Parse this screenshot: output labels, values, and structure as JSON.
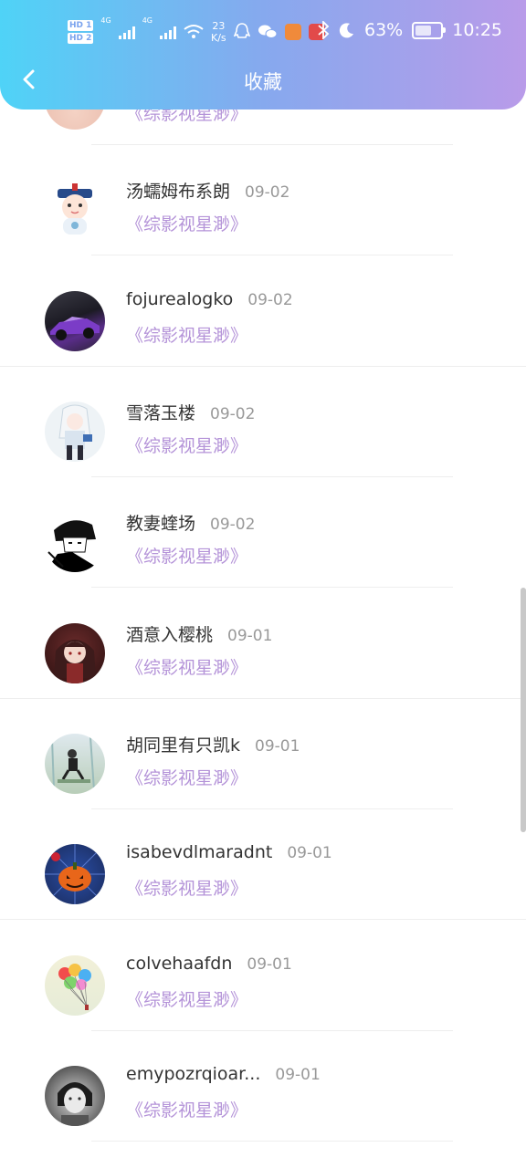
{
  "status": {
    "hd1": "HD 1",
    "hd2": "HD 2",
    "net1": "4G",
    "net2": "4G",
    "speed_value": "23",
    "speed_unit": "K/s",
    "battery": "63%",
    "battery_level": 0.63,
    "time": "10:25"
  },
  "header": {
    "title": "收藏"
  },
  "list": {
    "items": [
      {
        "name": "",
        "date": "",
        "book": "《综影视星渺》",
        "avatar": "partial-avatar"
      },
      {
        "name": "汤蠕姆布系朗",
        "date": "09-02",
        "book": "《综影视星渺》",
        "avatar": "cartoon-official-avatar"
      },
      {
        "name": "fojurealogko",
        "date": "09-02",
        "book": "《综影视星渺》",
        "avatar": "purple-car-avatar"
      },
      {
        "name": "雪落玉楼",
        "date": "09-02",
        "book": "《综影视星渺》",
        "avatar": "anime-white-hair-avatar"
      },
      {
        "name": "教妻蝰场",
        "date": "09-02",
        "book": "《综影视星渺》",
        "avatar": "sketch-portrait-avatar"
      },
      {
        "name": "酒意入樱桃",
        "date": "09-01",
        "book": "《综影视星渺》",
        "avatar": "anime-girl-avatar"
      },
      {
        "name": "胡同里有只凯k",
        "date": "09-01",
        "book": "《综影视星渺》",
        "avatar": "seated-figure-avatar"
      },
      {
        "name": "isabevdlmaradnt",
        "date": "09-01",
        "book": "《综影视星渺》",
        "avatar": "pumpkin-avatar"
      },
      {
        "name": "colvehaafdn",
        "date": "09-01",
        "book": "《综影视星渺》",
        "avatar": "balloons-avatar"
      },
      {
        "name": "emypozrqioar...",
        "date": "09-01",
        "book": "《综影视星渺》",
        "avatar": "bw-photo-avatar"
      }
    ]
  }
}
